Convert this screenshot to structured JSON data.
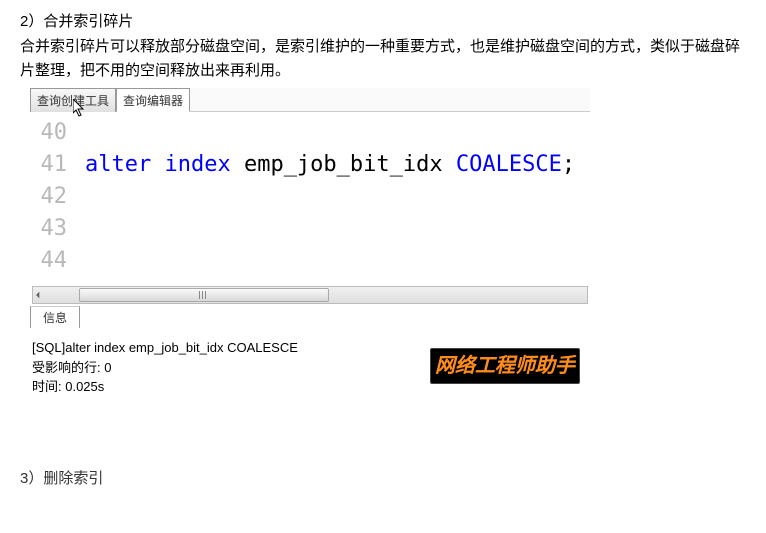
{
  "headings": {
    "section2": "2）合并索引碎片",
    "section3": "3）删除索引"
  },
  "description": "合并索引碎片可以释放部分磁盘空间，是索引维护的一种重要方式，也是维护磁盘空间的方式，类似于磁盘碎片整理，把不用的空间释放出来再利用。",
  "tabs": {
    "create_tool": "查询创建工具",
    "editor": "查询编辑器"
  },
  "code": {
    "lines": [
      {
        "num": "40",
        "tokens": []
      },
      {
        "num": "41",
        "tokens": [
          {
            "t": "alter index ",
            "cls": "kw-blue"
          },
          {
            "t": "emp_job_bit_idx ",
            "cls": "txt-black"
          },
          {
            "t": "COALESCE",
            "cls": "kw-blue"
          },
          {
            "t": ";",
            "cls": "txt-black"
          }
        ]
      },
      {
        "num": "42",
        "tokens": []
      },
      {
        "num": "43",
        "tokens": []
      },
      {
        "num": "44",
        "tokens": []
      }
    ]
  },
  "bottom_tab": "信息",
  "info": {
    "line1": "[SQL]alter index emp_job_bit_idx COALESCE",
    "line2": "受影响的行: 0",
    "line3": "时间: 0.025s"
  },
  "watermark": "网络工程师助手"
}
